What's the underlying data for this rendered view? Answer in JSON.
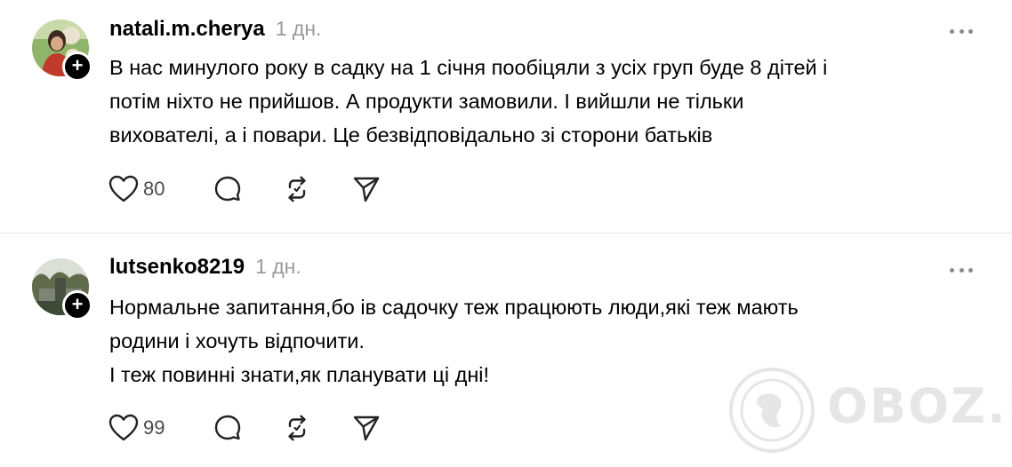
{
  "posts": [
    {
      "username": "natali.m.cherya",
      "timestamp": "1 дн.",
      "body_lines": [
        "В нас минулого року в садку на 1 січня пообіцяли з усіх груп буде 8 дітей і",
        "потім ніхто не прийшов. А продукти замовили. І вийшли не тільки",
        "вихователі, а і повари. Це безвідповідально зі сторони батьків"
      ],
      "likes": "80"
    },
    {
      "username": "lutsenko8219",
      "timestamp": "1 дн.",
      "body_lines": [
        "Нормальне запитання,бо ів садочку теж працюють люди,які теж мають",
        "родини і хочуть відпочити.",
        "І теж повинні знати,як планувати ці дні!"
      ],
      "likes": "99"
    }
  ],
  "follow_symbol": "+",
  "watermark": "OBOZ.UA",
  "icons": [
    "heart-icon",
    "reply-bubble-icon",
    "repost-icon",
    "share-send-icon",
    "more-dots-icon",
    "globe-icon"
  ]
}
